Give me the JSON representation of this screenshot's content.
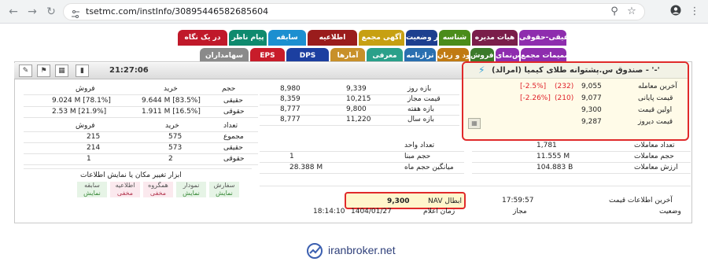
{
  "browser": {
    "url": "tsetmc.com/instInfo/30895446582685604",
    "back_icon": "arrow-left",
    "forward_icon": "arrow-right",
    "reload_icon": "reload",
    "tune_icon": "site-settings",
    "zoom_icon": "zoom",
    "star_icon": "star",
    "avatar_icon": "profile",
    "menu_icon": "kebab"
  },
  "tabs_row1": [
    {
      "label": "حقیقی-حقوقی",
      "color": "#8e2dae"
    },
    {
      "label": "هیات مدیره",
      "color": "#7a1e4a"
    },
    {
      "label": "شناسه",
      "color": "#4a8c1a"
    },
    {
      "label": "تغییر وضعیت",
      "color": "#1d3f8f"
    },
    {
      "label": "آگهی مجمع",
      "color": "#c7a012"
    },
    {
      "label": "اطلاعیه",
      "color": "#9a1c1c"
    },
    {
      "label": "سابقه",
      "color": "#1c8fd0"
    },
    {
      "label": "پیام ناظر",
      "color": "#0f8a6e"
    },
    {
      "label": "در یک نگاه",
      "color": "#c0192a"
    }
  ],
  "tabs_row2": [
    {
      "label": "تصمیمات مجمع",
      "color": "#8e2dae"
    },
    {
      "label": "بورس‌نمای",
      "color": "#8e2dae"
    },
    {
      "label": "تولید و فروش",
      "color": "#3b7a2a"
    },
    {
      "label": "سود و زیان",
      "color": "#c07a12"
    },
    {
      "label": "ترازنامه",
      "color": "#2a6fb0"
    },
    {
      "label": "معرفی",
      "color": "#2aa08a"
    },
    {
      "label": "آمارها",
      "color": "#c8902a"
    },
    {
      "label": "DPS",
      "color": "#1c3fa0"
    },
    {
      "label": "EPS",
      "color": "#c81c2a"
    },
    {
      "label": "سهامداران",
      "color": "#8a8a8a"
    }
  ],
  "toolbar": {
    "time": "21:27:06",
    "icons": [
      "edit-icon",
      "flag-icon",
      "grid-icon",
      "chart-icon"
    ]
  },
  "fund": {
    "title": "صندوق س.پشتوانه طلای کیمیا (امرالد) - '-'",
    "rows": [
      {
        "label": "آخرین معامله",
        "value": "9,055",
        "change": "(232)",
        "pct": "[-2.5%]"
      },
      {
        "label": "قیمت پایانی",
        "value": "9,077",
        "change": "(210)",
        "pct": "[-2.26%]"
      },
      {
        "label": "اولین قیمت",
        "value": "9,300"
      },
      {
        "label": "قیمت دیروز",
        "value": "9,287"
      }
    ]
  },
  "ranges": [
    {
      "label": "بازه روز",
      "a": "9,339",
      "b": "8,980"
    },
    {
      "label": "قیمت مجاز",
      "a": "10,215",
      "b": "8,359"
    },
    {
      "label": "بازه هفته",
      "a": "9,800",
      "b": "8,777"
    },
    {
      "label": "بازه سال",
      "a": "11,220",
      "b": "8,777"
    }
  ],
  "trades": {
    "header": {
      "h": "حجم",
      "k": "خرید",
      "f": "فروش"
    },
    "rows": [
      {
        "h": "حقیقی",
        "k": "9.644 M [83.5%]",
        "f": "9.024 M [78.1%]"
      },
      {
        "h": "حقوقی",
        "k": "1.911 M [16.5%]",
        "f": "2.53 M [21.9%]"
      }
    ],
    "count_header": {
      "h": "تعداد",
      "k": "خرید",
      "f": "فروش"
    },
    "count_rows": [
      {
        "h": "مجموع",
        "k": "575",
        "f": "215"
      },
      {
        "h": "حقیقی",
        "k": "573",
        "f": "214"
      },
      {
        "h": "حقوقی",
        "k": "2",
        "f": "1"
      }
    ]
  },
  "stats": [
    {
      "label": "تعداد معاملات",
      "value": "1,781"
    },
    {
      "label": "حجم معاملات",
      "value": "11.555 M"
    },
    {
      "label": "ارزش معاملات",
      "value": "104.883 B"
    }
  ],
  "stats2": [
    {
      "label": "تعداد واحد",
      "value": ""
    },
    {
      "label": "حجم مبنا",
      "value": "1"
    },
    {
      "label": "میانگین حجم ماه",
      "value": "28.388 M"
    }
  ],
  "tools": {
    "title": "ابزار تغییر مکان یا نمایش اطلاعات",
    "items": [
      {
        "top": "سفارش",
        "bottom": "نمایش",
        "color": "#e6f4e6",
        "text": "#3a8a3a"
      },
      {
        "top": "نمودار",
        "bottom": "نمایش",
        "color": "#e6f4e6",
        "text": "#3a8a3a"
      },
      {
        "top": "همگروه",
        "bottom": "مخفی",
        "color": "#fbe9ee",
        "text": "#b3364f"
      },
      {
        "top": "اطلاعیه",
        "bottom": "مخفی",
        "color": "#fbe9ee",
        "text": "#b3364f"
      },
      {
        "top": "سابقه",
        "bottom": "نمایش",
        "color": "#e6f4e6",
        "text": "#3a8a3a"
      }
    ]
  },
  "info": {
    "last_update_label": "آخرین اطلاعات قیمت",
    "last_update_time": "17:59:57",
    "status_label": "وضعیت",
    "status_value": "مجاز",
    "nav_label": "NAV ابطال",
    "nav_value": "9,300",
    "announce_label": "زمان اعلام",
    "announce_date": "1404/01/27",
    "announce_time": "18:14:10"
  },
  "footer": {
    "brand": "iranbroker.net"
  }
}
